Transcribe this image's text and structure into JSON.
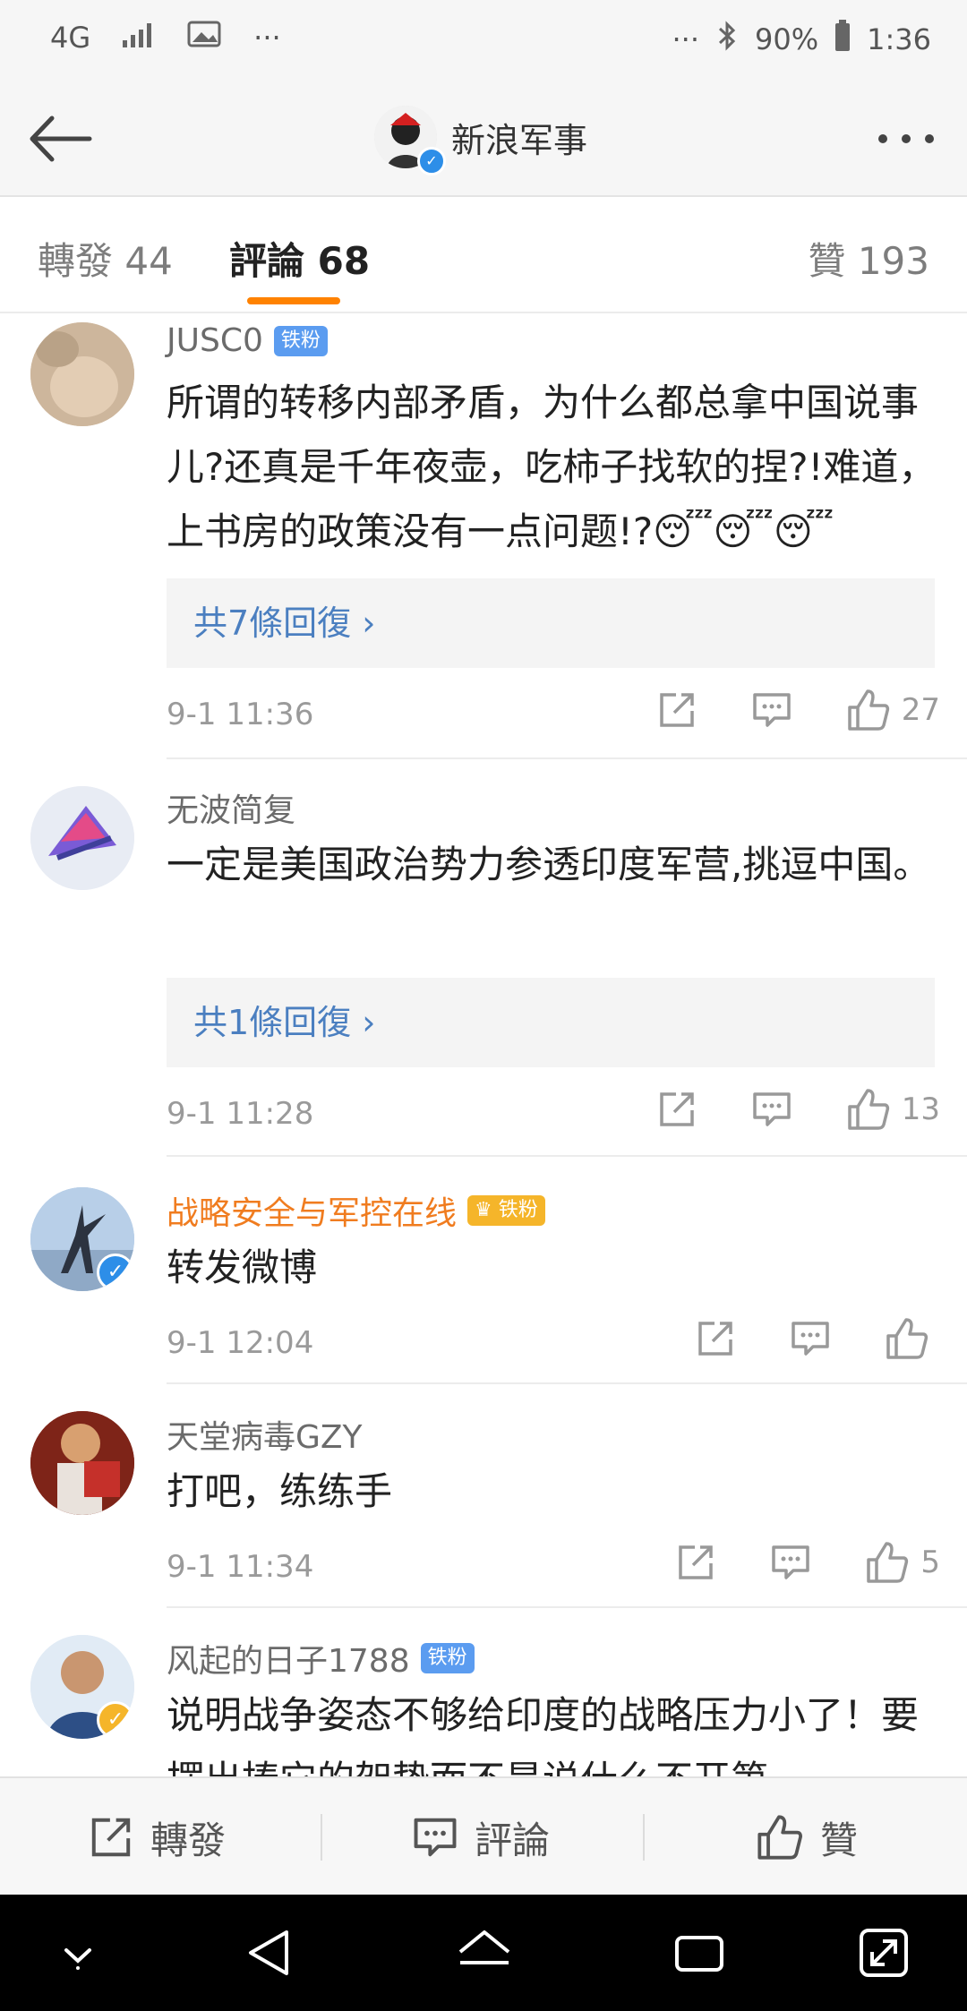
{
  "status_bar": {
    "network": "4G",
    "signal": "signal-icon",
    "extra": "···",
    "battery": "90%",
    "time": "1:36"
  },
  "header": {
    "title": "新浪军事"
  },
  "tabs": [
    {
      "label": "轉發 44"
    },
    {
      "label": "評論 68"
    },
    {
      "label": "贊 193"
    }
  ],
  "comments": [
    {
      "username": "JUSC0",
      "badge": "铁粉",
      "text": "所谓的转移内部矛盾，为什么都总拿中国说事儿?还真是千年夜壶，吃柿子找软的捏?!难道，上书房的政策没有一点问题!?😴😴😴",
      "replies": "共7條回復 ›",
      "time": "9-1 11:36",
      "likes": "27"
    },
    {
      "username": "无波简复",
      "badge": "",
      "text": "一定是美国政治势力参透印度军营,挑逗中国。",
      "replies": "共1條回復 ›",
      "time": "9-1 11:28",
      "likes": "13"
    },
    {
      "username": "战略安全与军控在线",
      "badge": "铁粉",
      "text": "转发微博",
      "replies": "",
      "time": "9-1 12:04",
      "likes": ""
    },
    {
      "username": "天堂病毒GZY",
      "badge": "",
      "text": "打吧，练练手",
      "replies": "",
      "time": "9-1 11:34",
      "likes": "5"
    },
    {
      "username": "风起的日子1788",
      "badge": "铁粉",
      "text": "说明战争姿态不够给印度的战略压力小了！要摆出揍它的架势而不是说什么不开第",
      "replies": "",
      "time": "",
      "likes": ""
    }
  ],
  "bottom_bar": {
    "repost": "轉發",
    "comment": "評論",
    "like": "贊"
  },
  "colors": {
    "accent": "#ff8200",
    "link": "#4b7fc0",
    "verified_blue": "#2d8ee8",
    "verified_gold": "#f5b52a"
  }
}
